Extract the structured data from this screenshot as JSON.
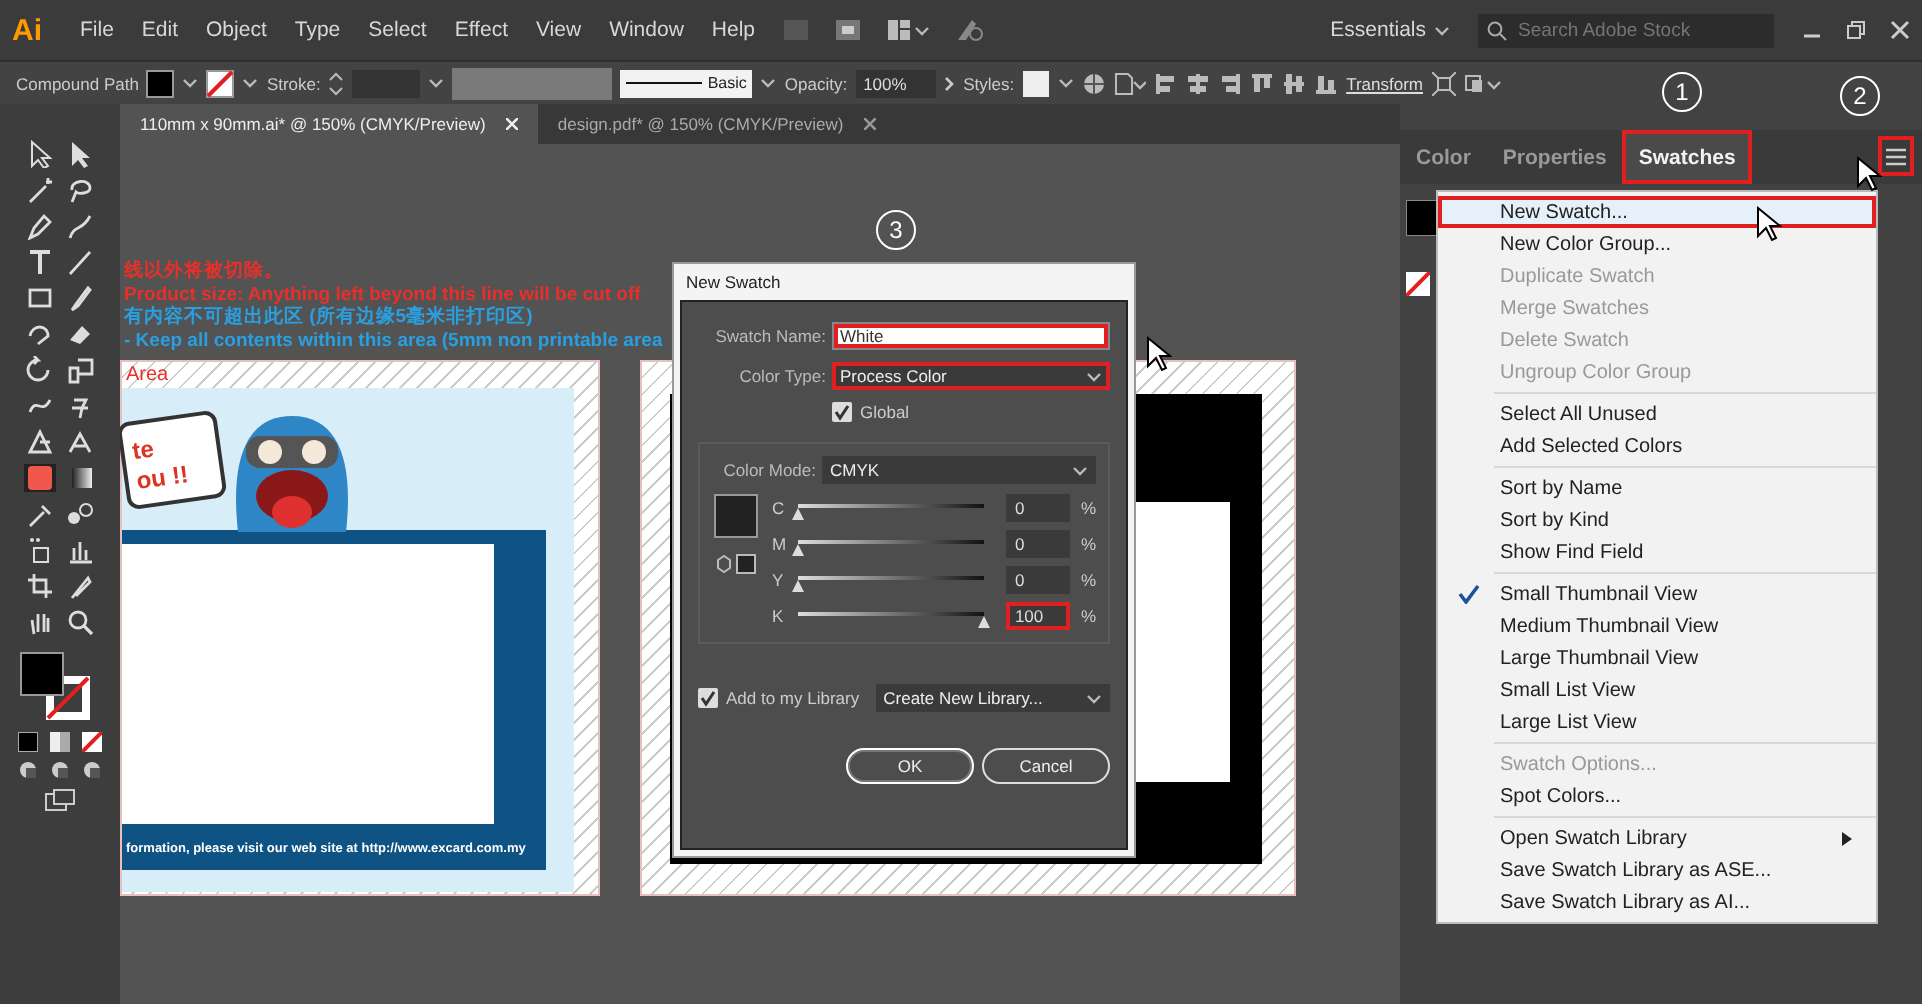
{
  "menubar": {
    "logo": "Ai",
    "menus": [
      "File",
      "Edit",
      "Object",
      "Type",
      "Select",
      "Effect",
      "View",
      "Window",
      "Help"
    ],
    "workspace": "Essentials",
    "search": {
      "placeholder": "Search Adobe Stock"
    }
  },
  "control_bar": {
    "selection": "Compound Path",
    "stroke_label": "Stroke:",
    "brush": "Basic",
    "opacity_label": "Opacity:",
    "opacity": "100%",
    "styles_label": "Styles:",
    "transform": "Transform"
  },
  "document_tabs": [
    {
      "label": "110mm x 90mm.ai* @ 150% (CMYK/Preview)",
      "selected": true
    },
    {
      "label": "design.pdf* @ 150% (CMYK/Preview)",
      "selected": false
    }
  ],
  "canvas": {
    "notes": [
      {
        "text": "线以外将被切除。",
        "color": "#e8302a"
      },
      {
        "text": "Product size: Anything left beyond this line will be cut off",
        "color": "#e8302a"
      },
      {
        "text": "有内容不可超出此区 (所有边缘5毫米非打印区)",
        "color": "#2a9fe0"
      },
      {
        "text": "- Keep all contents within this area (5mm non printable area",
        "color": "#2a9fe0"
      }
    ],
    "area_label": "Area",
    "bubble_lines": [
      "te",
      "ou !!"
    ],
    "footer": "formation, please visit our web site at http://www.excard.com.my"
  },
  "dialog": {
    "title": "New Swatch",
    "swatch_name": {
      "label": "Swatch Name:",
      "value": "White",
      "callout": true
    },
    "color_type": {
      "label": "Color Type:",
      "value": "Process Color",
      "callout": true
    },
    "global": {
      "label": "Global",
      "checked": true
    },
    "color_mode": {
      "label": "Color Mode:",
      "value": "CMYK"
    },
    "sliders": [
      {
        "channel": "C",
        "level": 0,
        "value": "0",
        "unit": "%",
        "callout": false
      },
      {
        "channel": "M",
        "level": 0,
        "value": "0",
        "unit": "%",
        "callout": false
      },
      {
        "channel": "Y",
        "level": 0,
        "value": "0",
        "unit": "%",
        "callout": false
      },
      {
        "channel": "K",
        "level": 1,
        "value": "100",
        "unit": "%",
        "callout": true
      }
    ],
    "add_to_library": {
      "label": "Add to my Library",
      "checked": true
    },
    "library": {
      "value": "Create New Library..."
    },
    "buttons": [
      {
        "label": "OK",
        "kind": "primary"
      },
      {
        "label": "Cancel",
        "kind": "secondary"
      }
    ]
  },
  "panel": {
    "tabs": [
      {
        "label": "Color",
        "selected": false,
        "callout": false
      },
      {
        "label": "Properties",
        "selected": false,
        "callout": false
      },
      {
        "label": "Swatches",
        "selected": true,
        "callout": true
      }
    ],
    "menu_button": {
      "callout": true
    }
  },
  "flyout": [
    {
      "kind": "item",
      "label": "New Swatch...",
      "selected": true,
      "disabled": false,
      "checked": false,
      "submenu": false,
      "callout": true
    },
    {
      "kind": "item",
      "label": "New Color Group...",
      "selected": false,
      "disabled": false,
      "checked": false,
      "submenu": false,
      "callout": false
    },
    {
      "kind": "item",
      "label": "Duplicate Swatch",
      "selected": false,
      "disabled": true,
      "checked": false,
      "submenu": false,
      "callout": false
    },
    {
      "kind": "item",
      "label": "Merge Swatches",
      "selected": false,
      "disabled": true,
      "checked": false,
      "submenu": false,
      "callout": false
    },
    {
      "kind": "item",
      "label": "Delete Swatch",
      "selected": false,
      "disabled": true,
      "checked": false,
      "submenu": false,
      "callout": false
    },
    {
      "kind": "item",
      "label": "Ungroup Color Group",
      "selected": false,
      "disabled": true,
      "checked": false,
      "submenu": false,
      "callout": false
    },
    {
      "kind": "separator"
    },
    {
      "kind": "item",
      "label": "Select All Unused",
      "selected": false,
      "disabled": false,
      "checked": false,
      "submenu": false,
      "callout": false
    },
    {
      "kind": "item",
      "label": "Add Selected Colors",
      "selected": false,
      "disabled": false,
      "checked": false,
      "submenu": false,
      "callout": false
    },
    {
      "kind": "separator"
    },
    {
      "kind": "item",
      "label": "Sort by Name",
      "selected": false,
      "disabled": false,
      "checked": false,
      "submenu": false,
      "callout": false
    },
    {
      "kind": "item",
      "label": "Sort by Kind",
      "selected": false,
      "disabled": false,
      "checked": false,
      "submenu": false,
      "callout": false
    },
    {
      "kind": "item",
      "label": "Show Find Field",
      "selected": false,
      "disabled": false,
      "checked": false,
      "submenu": false,
      "callout": false
    },
    {
      "kind": "separator"
    },
    {
      "kind": "item",
      "label": "Small Thumbnail View",
      "selected": false,
      "disabled": false,
      "checked": true,
      "submenu": false,
      "callout": false
    },
    {
      "kind": "item",
      "label": "Medium Thumbnail View",
      "selected": false,
      "disabled": false,
      "checked": false,
      "submenu": false,
      "callout": false
    },
    {
      "kind": "item",
      "label": "Large Thumbnail View",
      "selected": false,
      "disabled": false,
      "checked": false,
      "submenu": false,
      "callout": false
    },
    {
      "kind": "item",
      "label": "Small List View",
      "selected": false,
      "disabled": false,
      "checked": false,
      "submenu": false,
      "callout": false
    },
    {
      "kind": "item",
      "label": "Large List View",
      "selected": false,
      "disabled": false,
      "checked": false,
      "submenu": false,
      "callout": false
    },
    {
      "kind": "separator"
    },
    {
      "kind": "item",
      "label": "Swatch Options...",
      "selected": false,
      "disabled": true,
      "checked": false,
      "submenu": false,
      "callout": false
    },
    {
      "kind": "item",
      "label": "Spot Colors...",
      "selected": false,
      "disabled": false,
      "checked": false,
      "submenu": false,
      "callout": false
    },
    {
      "kind": "separator"
    },
    {
      "kind": "item",
      "label": "Open Swatch Library",
      "selected": false,
      "disabled": false,
      "checked": false,
      "submenu": true,
      "callout": false
    },
    {
      "kind": "item",
      "label": "Save Swatch Library as ASE...",
      "selected": false,
      "disabled": false,
      "checked": false,
      "submenu": false,
      "callout": false
    },
    {
      "kind": "item",
      "label": "Save Swatch Library as AI...",
      "selected": false,
      "disabled": false,
      "checked": false,
      "submenu": false,
      "callout": false
    }
  ],
  "annotations": [
    "1",
    "2",
    "3"
  ]
}
